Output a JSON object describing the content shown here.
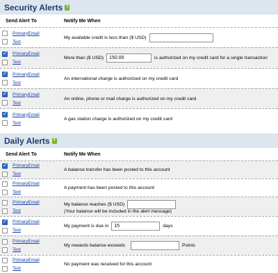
{
  "security": {
    "title": "Security Alerts",
    "header": {
      "send": "Send Alert To",
      "notify": "Notify Me When"
    },
    "rows": [
      {
        "email_label": "PrimaryEmail",
        "text_label": "Text",
        "email_checked": false,
        "text_checked": false,
        "text": "My available credit is less than ($ USD)",
        "input": ""
      },
      {
        "email_label": "PrimaryEmail",
        "text_label": "Text",
        "email_checked": true,
        "text_checked": false,
        "pre": "More than ($ USD)",
        "input": "150.00",
        "post": "is authorized on my credit card for a single transaction"
      },
      {
        "email_label": "PrimaryEmail",
        "text_label": "Text",
        "email_checked": true,
        "text_checked": false,
        "text": "An international charge is authorized on my credit card"
      },
      {
        "email_label": "PrimaryEmail",
        "text_label": "Text",
        "email_checked": true,
        "text_checked": false,
        "text": "An online, phone or mail charge is authorized on my credit card"
      },
      {
        "email_label": "PrimaryEmail",
        "text_label": "Text",
        "email_checked": true,
        "text_checked": false,
        "text": "A gas station charge is authorized on my credit card"
      }
    ]
  },
  "daily": {
    "title": "Daily Alerts",
    "header": {
      "send": "Send Alert To",
      "notify": "Notify Me When"
    },
    "rows": [
      {
        "email_label": "PrimaryEmail",
        "text_label": "Text",
        "email_checked": true,
        "text_checked": false,
        "text": "A balance transfer has been posted to this account"
      },
      {
        "email_label": "PrimaryEmail",
        "text_label": "Text",
        "email_checked": false,
        "text_checked": false,
        "text": "A payment has been posted to this account"
      },
      {
        "email_label": "PrimaryEmail",
        "text_label": "Text",
        "email_checked": false,
        "text_checked": false,
        "text": "My balance reaches ($ USD)",
        "input": "",
        "note": "(Your balance will be included in the alert message)"
      },
      {
        "email_label": "PrimaryEmail",
        "text_label": "Text",
        "email_checked": true,
        "text_checked": false,
        "pre": "My payment is due in",
        "input": "15",
        "post": "days"
      },
      {
        "email_label": "PrimaryEmail",
        "text_label": "Text",
        "email_checked": false,
        "text_checked": false,
        "pre": "My rewards balance exceeds",
        "input": "",
        "post": "Points"
      },
      {
        "email_label": "PrimaryEmail",
        "text_label": "Text",
        "email_checked": false,
        "text_checked": false,
        "text": "No payment was received for this account"
      }
    ]
  }
}
